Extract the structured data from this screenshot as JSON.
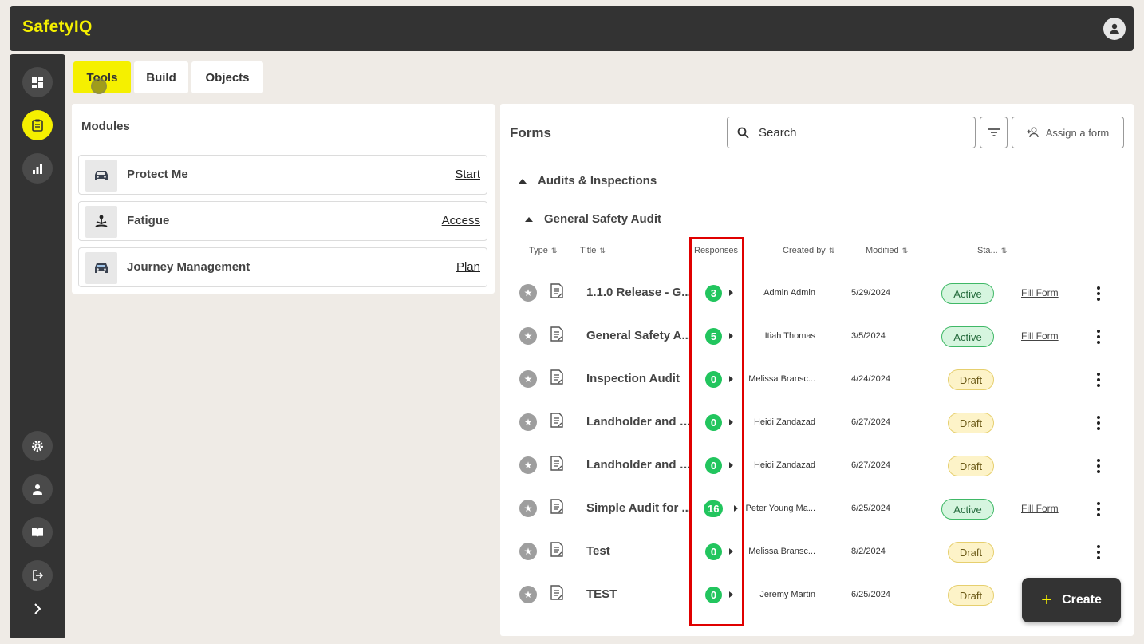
{
  "app": {
    "logo": "SafetyIQ"
  },
  "tabs": [
    {
      "label": "Tools",
      "active": true
    },
    {
      "label": "Build",
      "active": false
    },
    {
      "label": "Objects",
      "active": false
    }
  ],
  "modules": {
    "title": "Modules",
    "items": [
      {
        "name": "Protect Me",
        "action": "Start",
        "icon": "car-icon"
      },
      {
        "name": "Fatigue",
        "action": "Access",
        "icon": "meditation-icon"
      },
      {
        "name": "Journey Management",
        "action": "Plan",
        "icon": "car-icon"
      }
    ]
  },
  "forms": {
    "title": "Forms",
    "search_placeholder": "Search",
    "assign_label": "Assign a form",
    "group": "Audits & Inspections",
    "subgroup": "General Safety Audit",
    "columns": {
      "type": "Type",
      "title": "Title",
      "responses": "Responses",
      "created_by": "Created by",
      "modified": "Modified",
      "status": "Sta..."
    },
    "rows": [
      {
        "title": "1.1.0 Release  - G...",
        "responses": "3",
        "created_by": "Admin Admin",
        "modified": "5/29/2024",
        "status": "Active",
        "fill": "Fill Form"
      },
      {
        "title": "General Safety A...",
        "responses": "5",
        "created_by": "Itiah Thomas",
        "modified": "3/5/2024",
        "status": "Active",
        "fill": "Fill Form"
      },
      {
        "title": "Inspection Audit",
        "responses": "0",
        "created_by": "Melissa Bransc...",
        "modified": "4/24/2024",
        "status": "Draft",
        "fill": ""
      },
      {
        "title": "Landholder and P...",
        "responses": "0",
        "created_by": "Heidi Zandazad",
        "modified": "6/27/2024",
        "status": "Draft",
        "fill": ""
      },
      {
        "title": "Landholder and P...",
        "responses": "0",
        "created_by": "Heidi Zandazad",
        "modified": "6/27/2024",
        "status": "Draft",
        "fill": ""
      },
      {
        "title": "Simple Audit for ...",
        "responses": "16",
        "created_by": "Peter Young Ma...",
        "modified": "6/25/2024",
        "status": "Active",
        "fill": "Fill Form"
      },
      {
        "title": "Test",
        "responses": "0",
        "created_by": "Melissa Bransc...",
        "modified": "8/2/2024",
        "status": "Draft",
        "fill": ""
      },
      {
        "title": "TEST",
        "responses": "0",
        "created_by": "Jeremy Martin",
        "modified": "6/25/2024",
        "status": "Draft",
        "fill": ""
      }
    ]
  },
  "create_label": "Create",
  "colors": {
    "accent": "#f5f000",
    "dark": "#333333",
    "badge": "#22c55e",
    "highlight": "#e00000"
  }
}
